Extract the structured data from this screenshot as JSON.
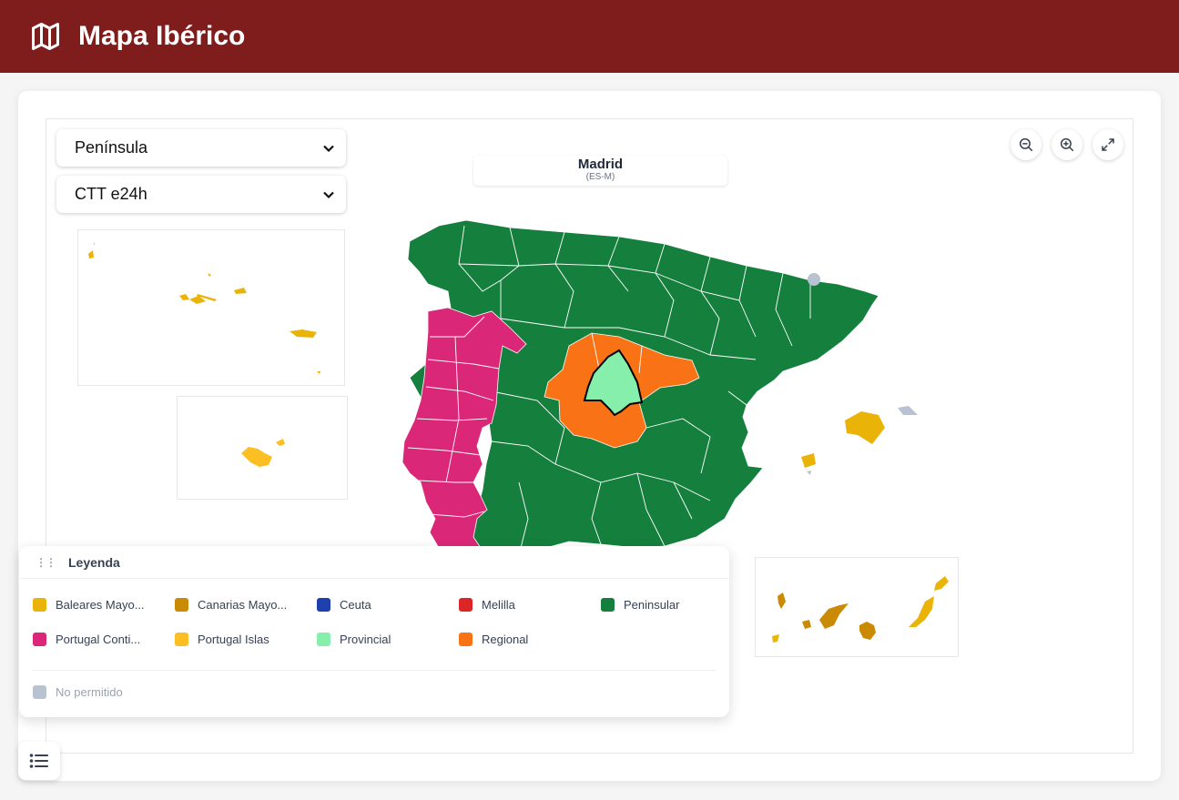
{
  "app": {
    "title": "Mapa Ibérico"
  },
  "controls": {
    "zone_select": "Península",
    "service_select": "CTT e24h"
  },
  "selected_region": {
    "name": "Madrid",
    "code": "(ES-M)"
  },
  "map_buttons": {
    "zoom_out": "zoom-out-icon",
    "zoom_in": "zoom-in-icon",
    "fullscreen": "expand-icon"
  },
  "colors": {
    "header": "#7f1d1d",
    "peninsular": "#15803d",
    "portugal_continental": "#db2777",
    "regional": "#f97316",
    "provincial": "#86efac",
    "baleares": "#eab308",
    "canarias": "#ca8a04",
    "portugal_islas": "#fbbf24",
    "ceuta": "#1e40af",
    "melilla": "#dc2626",
    "no_permitido": "#b8c2d1"
  },
  "legend": {
    "title": "Leyenda",
    "items": [
      {
        "label": "Baleares Mayo...",
        "color": "#eab308"
      },
      {
        "label": "Canarias Mayo...",
        "color": "#ca8a04"
      },
      {
        "label": "Ceuta",
        "color": "#1e40af"
      },
      {
        "label": "Melilla",
        "color": "#dc2626"
      },
      {
        "label": "Peninsular",
        "color": "#15803d"
      },
      {
        "label": "Portugal Conti...",
        "color": "#db2777"
      },
      {
        "label": "Portugal Islas",
        "color": "#fbbf24"
      },
      {
        "label": "Provincial",
        "color": "#86efac"
      },
      {
        "label": "Regional",
        "color": "#f97316"
      }
    ],
    "disabled": {
      "label": "No permitido",
      "color": "#b8c2d1"
    }
  }
}
